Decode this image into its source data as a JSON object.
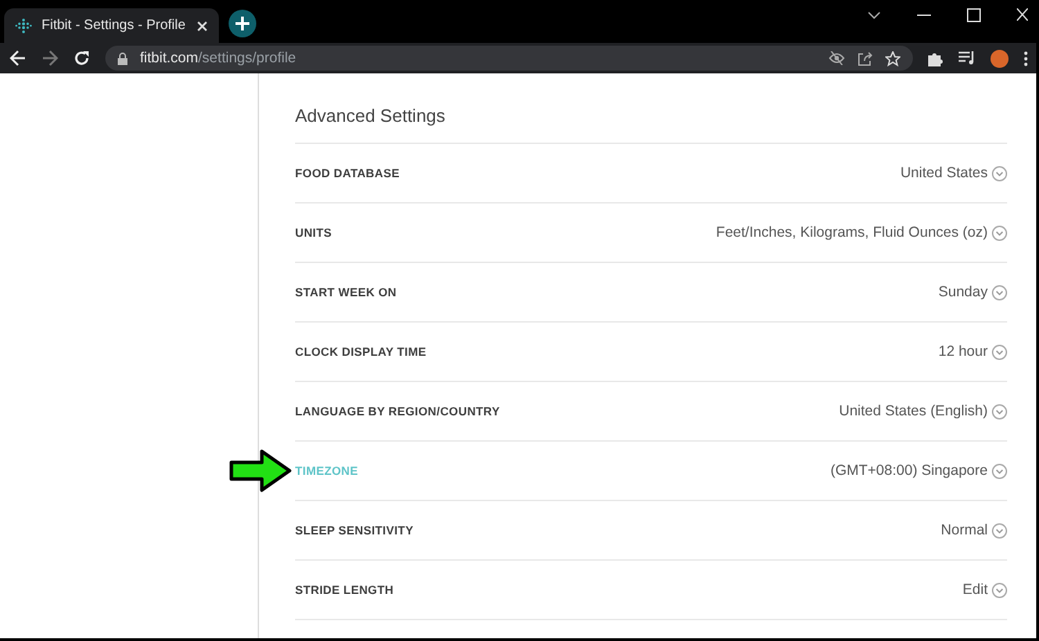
{
  "browser": {
    "tab_title": "Fitbit - Settings - Profile",
    "url_host": "fitbit.com",
    "url_path": "/settings/profile"
  },
  "section_title": "Advanced Settings",
  "settings": [
    {
      "label": "FOOD DATABASE",
      "value": "United States",
      "highlighted": false
    },
    {
      "label": "UNITS",
      "value": "Feet/Inches, Kilograms, Fluid Ounces (oz)",
      "highlighted": false
    },
    {
      "label": "START WEEK ON",
      "value": "Sunday",
      "highlighted": false
    },
    {
      "label": "CLOCK DISPLAY TIME",
      "value": "12 hour",
      "highlighted": false
    },
    {
      "label": "LANGUAGE BY REGION/COUNTRY",
      "value": "United States (English)",
      "highlighted": false
    },
    {
      "label": "TIMEZONE",
      "value": "(GMT+08:00) Singapore",
      "highlighted": true
    },
    {
      "label": "SLEEP SENSITIVITY",
      "value": "Normal",
      "highlighted": false
    },
    {
      "label": "STRIDE LENGTH",
      "value": "Edit",
      "highlighted": false
    }
  ]
}
